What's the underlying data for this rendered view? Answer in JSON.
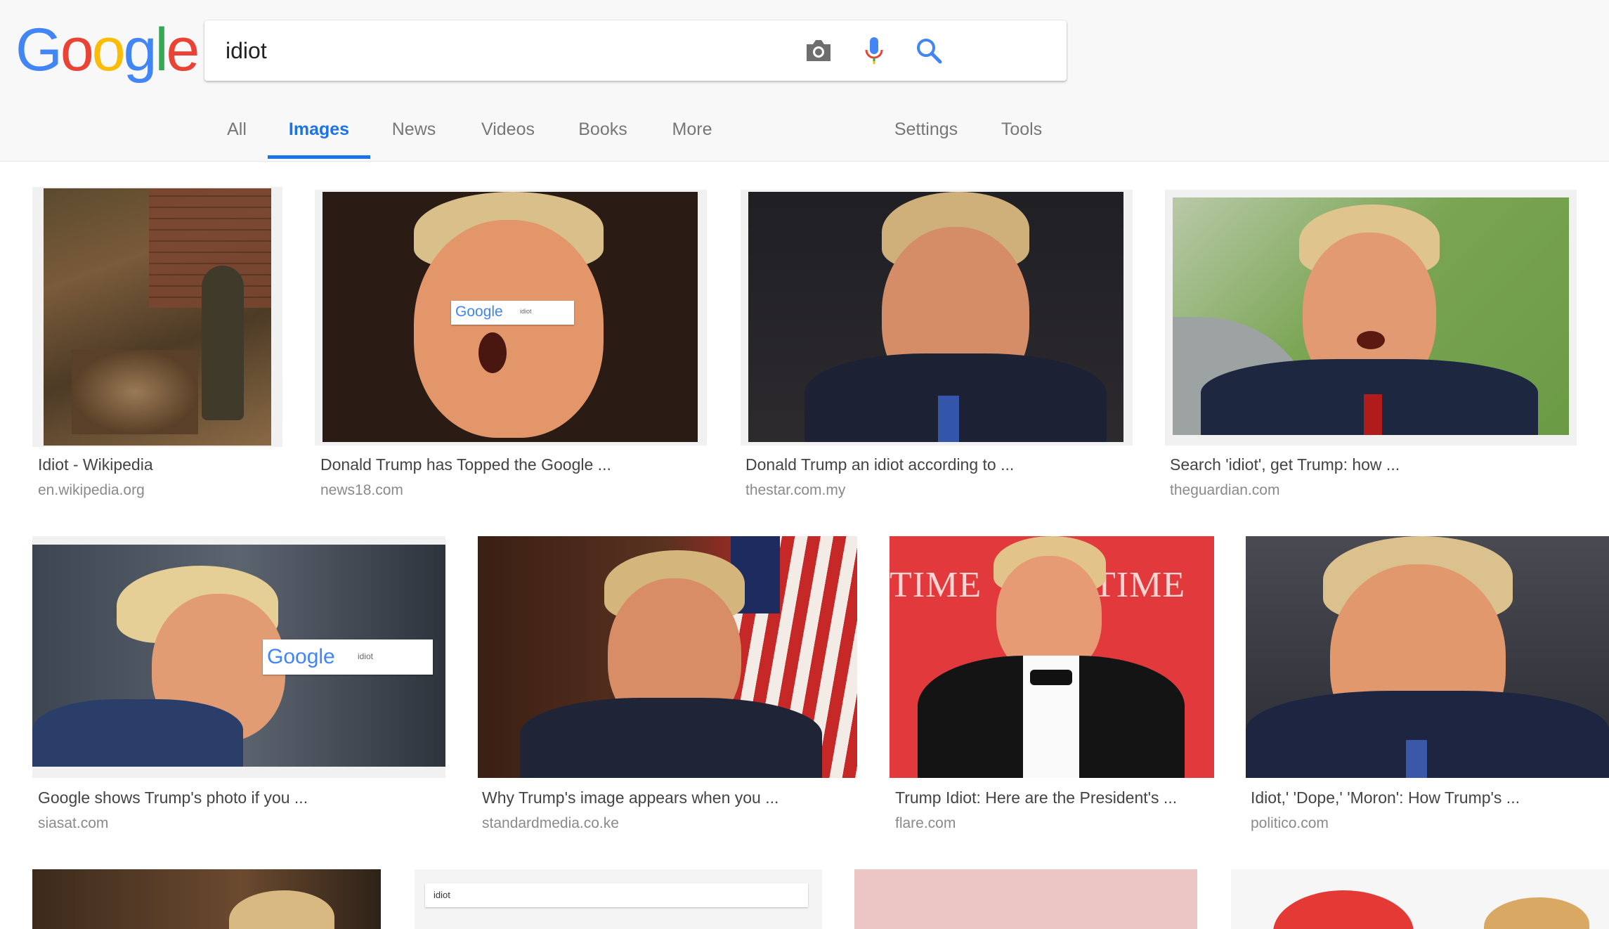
{
  "logo": {
    "letters": [
      "G",
      "o",
      "o",
      "g",
      "l",
      "e"
    ],
    "colors": [
      "#4285F4",
      "#EA4335",
      "#FBBC05",
      "#4285F4",
      "#34A853",
      "#EA4335"
    ]
  },
  "search": {
    "query": "idiot"
  },
  "icons": {
    "camera": "camera-icon",
    "mic": "microphone-icon",
    "search": "search-icon"
  },
  "tabs": [
    {
      "label": "All"
    },
    {
      "label": "Images"
    },
    {
      "label": "News"
    },
    {
      "label": "Videos"
    },
    {
      "label": "Books"
    },
    {
      "label": "More"
    },
    {
      "label": "Settings"
    },
    {
      "label": "Tools"
    }
  ],
  "active_tab": "Images",
  "accent_color": "#1a73e8",
  "results": [
    {
      "title": "Idiot - Wikipedia",
      "domain": "en.wikipedia.org"
    },
    {
      "title": "Donald Trump has Topped the Google ...",
      "domain": "news18.com"
    },
    {
      "title": "Donald Trump an idiot according to ...",
      "domain": "thestar.com.my"
    },
    {
      "title": "Search 'idiot', get Trump: how ...",
      "domain": "theguardian.com"
    },
    {
      "title": "Google shows Trump's photo if you ...",
      "domain": "siasat.com"
    },
    {
      "title": "Why Trump's image appears when you ...",
      "domain": "standardmedia.co.ke"
    },
    {
      "title": "Trump Idiot: Here are the President's ...",
      "domain": "flare.com"
    },
    {
      "title": "Idiot,' 'Dope,' 'Moron': How Trump's ...",
      "domain": "politico.com"
    }
  ],
  "overlays": {
    "google_word": "Google",
    "query_word": "idiot",
    "time_word": "TIME"
  }
}
